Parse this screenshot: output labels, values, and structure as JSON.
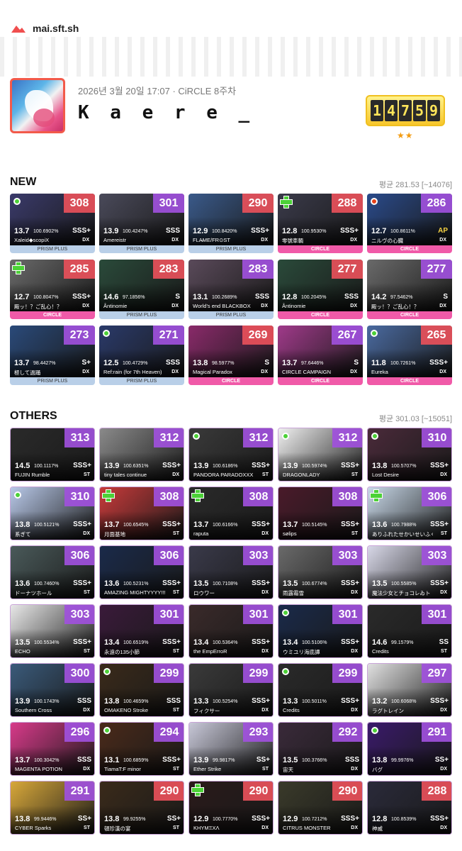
{
  "site": {
    "name": "mai.sft.sh"
  },
  "profile": {
    "date": "2026년 3월 20일 17:07 · CiRCLE 8주차",
    "name": "K a e r e _",
    "rating": "14759",
    "rating_digits": [
      "1",
      "4",
      "7",
      "5",
      "9"
    ],
    "stars": "★★"
  },
  "new": {
    "title": "NEW",
    "avg": "평균 281.53 [~14076]",
    "cards": [
      {
        "score": "308",
        "lvl": "13.7",
        "acc": "100.6902%",
        "rank": "SSS+",
        "title": "Xaleid◆scopiX",
        "type": "DX",
        "ver": "PRISM PLUS",
        "mark": "dot-green",
        "color": "#3a3a6a"
      },
      {
        "score": "301",
        "lvl": "13.9",
        "acc": "100.4247%",
        "rank": "SSS",
        "title": "Amereistr",
        "type": "DX",
        "ver": "PRISM PLUS",
        "mark": "",
        "color": "#4a4a5a"
      },
      {
        "score": "290",
        "lvl": "12.9",
        "acc": "100.8420%",
        "rank": "SSS+",
        "title": "FLA̶ME/FR⊙ST",
        "type": "DX",
        "ver": "PRISM PLUS",
        "mark": "",
        "color": "#3a5a8a"
      },
      {
        "score": "288",
        "lvl": "12.8",
        "acc": "100.9530%",
        "rank": "SSS+",
        "title": "零號車輌",
        "type": "DX",
        "ver": "CIRCLE",
        "mark": "plus",
        "color": "#3a3a4a"
      },
      {
        "score": "286",
        "lvl": "12.7",
        "acc": "100.8611%",
        "rank": "AP",
        "title": "ニルヴの心臓",
        "type": "DX",
        "ver": "CIRCLE",
        "mark": "dot-red",
        "color": "#2a4a8a"
      },
      {
        "score": "285",
        "lvl": "12.7",
        "acc": "100.8047%",
        "rank": "SSS+",
        "title": "殿ッ！？ご乱心！？",
        "type": "DX",
        "ver": "CIRCLE",
        "mark": "plus",
        "color": "#6a6a6a"
      },
      {
        "score": "283",
        "lvl": "14.6",
        "acc": "97.1856%",
        "rank": "S",
        "title": "Ântinomie",
        "type": "DX",
        "ver": "PRISM PLUS",
        "mark": "",
        "color": "#2a4a3a"
      },
      {
        "score": "283",
        "lvl": "13.1",
        "acc": "100.2689%",
        "rank": "SSS",
        "title": "World's end BLACKBOX",
        "type": "DX",
        "ver": "PRISM PLUS",
        "mark": "",
        "color": "#5a4a5a"
      },
      {
        "score": "277",
        "lvl": "12.8",
        "acc": "100.2045%",
        "rank": "SSS",
        "title": "Ântinomie",
        "type": "DX",
        "ver": "CIRCLE",
        "mark": "",
        "color": "#2a4a3a"
      },
      {
        "score": "277",
        "lvl": "14.2",
        "acc": "97.5462%",
        "rank": "S",
        "title": "殿ッ！？ご乱心！？",
        "type": "DX",
        "ver": "CIRCLE",
        "mark": "",
        "color": "#6a6a6a"
      },
      {
        "score": "273",
        "lvl": "13.7",
        "acc": "98.4427%",
        "rank": "S+",
        "title": "極して過踊",
        "type": "DX",
        "ver": "PRISM PLUS",
        "mark": "",
        "color": "#2a4a7a"
      },
      {
        "score": "271",
        "lvl": "12.5",
        "acc": "100.4729%",
        "rank": "SSS",
        "title": "Ref:rain (for 7th Heaven)",
        "type": "DX",
        "ver": "PRISM PLUS",
        "mark": "dot-green",
        "color": "#2a3a6a"
      },
      {
        "score": "269",
        "lvl": "13.8",
        "acc": "98.5977%",
        "rank": "S",
        "title": "Magical Paradox",
        "type": "DX",
        "ver": "CIRCLE",
        "mark": "",
        "color": "#8a2a6a"
      },
      {
        "score": "267",
        "lvl": "13.7",
        "acc": "97.6446%",
        "rank": "S",
        "title": "CIRCLE CAMPAIGN",
        "type": "DX",
        "ver": "CIRCLE",
        "mark": "",
        "color": "#a03a8a"
      },
      {
        "score": "265",
        "lvl": "11.8",
        "acc": "100.7261%",
        "rank": "SSS+",
        "title": "Eureka",
        "type": "DX",
        "ver": "CIRCLE",
        "mark": "dot-green",
        "color": "#4a6aa0"
      }
    ]
  },
  "others": {
    "title": "OTHERS",
    "avg": "평균 301.03 [~15051]",
    "cards": [
      {
        "score": "313",
        "lvl": "14.5",
        "acc": "100.1117%",
        "rank": "SSS+",
        "title": "FUJIN Rumble",
        "type": "ST",
        "mark": "",
        "color": "#2a2a2a"
      },
      {
        "score": "312",
        "lvl": "13.9",
        "acc": "100.6351%",
        "rank": "SSS+",
        "title": "tiny tales continue",
        "type": "DX",
        "mark": "",
        "color": "#8a8a8a"
      },
      {
        "score": "312",
        "lvl": "13.9",
        "acc": "100.6186%",
        "rank": "SSS+",
        "title": "PANDORA PARADOXXX",
        "type": "ST",
        "mark": "dot-green",
        "color": "#3a3a3a"
      },
      {
        "score": "312",
        "lvl": "13.9",
        "acc": "100.5974%",
        "rank": "SSS+",
        "title": "DRAGONLADY",
        "type": "ST",
        "mark": "dot-green",
        "color": "#f0f0f0"
      },
      {
        "score": "310",
        "lvl": "13.8",
        "acc": "100.5707%",
        "rank": "SSS+",
        "title": "Lost Desire",
        "type": "DX",
        "mark": "dot-green",
        "color": "#4a2a3a"
      },
      {
        "score": "310",
        "lvl": "13.8",
        "acc": "100.5121%",
        "rank": "SSS+",
        "title": "系ぎて",
        "type": "DX",
        "mark": "dot-green",
        "color": "#b8c8e8"
      },
      {
        "score": "308",
        "lvl": "13.7",
        "acc": "100.6545%",
        "rank": "SSS+",
        "title": "月面基地",
        "type": "ST",
        "mark": "plus",
        "color": "#c83a3a"
      },
      {
        "score": "308",
        "lvl": "13.7",
        "acc": "100.6166%",
        "rank": "SSS+",
        "title": "raputa",
        "type": "DX",
        "mark": "plus",
        "color": "#2a2a2a"
      },
      {
        "score": "308",
        "lvl": "13.7",
        "acc": "100.5145%",
        "rank": "SSS+",
        "title": "sølips",
        "type": "ST",
        "mark": "",
        "color": "#4a1a2a"
      },
      {
        "score": "306",
        "lvl": "13.6",
        "acc": "100.7988%",
        "rank": "SSS+",
        "title": "ありふれたせかいせいふく",
        "type": "ST",
        "mark": "plus",
        "color": "#c8d8e8"
      },
      {
        "score": "306",
        "lvl": "13.6",
        "acc": "100.7460%",
        "rank": "SSS+",
        "title": "ドーナツホール",
        "type": "ST",
        "mark": "",
        "color": "#4a5a5a"
      },
      {
        "score": "306",
        "lvl": "13.6",
        "acc": "100.5231%",
        "rank": "SSS+",
        "title": "AMAZING MIGHTYYYY!!!!",
        "type": "ST",
        "mark": "",
        "color": "#1a2a4a"
      },
      {
        "score": "303",
        "lvl": "13.5",
        "acc": "100.7108%",
        "rank": "SSS+",
        "title": "ロウワー",
        "type": "DX",
        "mark": "",
        "color": "#3a3a4a"
      },
      {
        "score": "303",
        "lvl": "13.5",
        "acc": "100.6774%",
        "rank": "SSS+",
        "title": "雨露霜雪",
        "type": "DX",
        "mark": "",
        "color": "#6a6a6a"
      },
      {
        "score": "303",
        "lvl": "13.5",
        "acc": "100.5585%",
        "rank": "SSS+",
        "title": "魔法少女とチョコレゐト",
        "type": "DX",
        "mark": "",
        "color": "#d8d8e8"
      },
      {
        "score": "303",
        "lvl": "13.5",
        "acc": "100.5534%",
        "rank": "SSS+",
        "title": "ECHO",
        "type": "ST",
        "mark": "",
        "color": "#e8e8e8"
      },
      {
        "score": "301",
        "lvl": "13.4",
        "acc": "100.6519%",
        "rank": "SSS+",
        "title": "永遠の135小節",
        "type": "ST",
        "mark": "",
        "color": "#3a1a3a"
      },
      {
        "score": "301",
        "lvl": "13.4",
        "acc": "100.5364%",
        "rank": "SSS+",
        "title": "the EmpErroR",
        "type": "DX",
        "mark": "",
        "color": "#3a2a2a"
      },
      {
        "score": "301",
        "lvl": "13.4",
        "acc": "100.5106%",
        "rank": "SSS+",
        "title": "ウミユリ海底譚",
        "type": "DX",
        "mark": "dot-green",
        "color": "#1a2a4a"
      },
      {
        "score": "301",
        "lvl": "14.6",
        "acc": "99.1579%",
        "rank": "SS",
        "title": "Credits",
        "type": "ST",
        "mark": "",
        "color": "#2a2a2a"
      },
      {
        "score": "300",
        "lvl": "13.9",
        "acc": "100.1743%",
        "rank": "SSS",
        "title": "Southern Cross",
        "type": "DX",
        "mark": "",
        "color": "#3a5a7a"
      },
      {
        "score": "299",
        "lvl": "13.8",
        "acc": "100.4659%",
        "rank": "SSS",
        "title": "OMAKENO Stroke",
        "type": "ST",
        "mark": "dot-green",
        "color": "#3a2a1a"
      },
      {
        "score": "299",
        "lvl": "13.3",
        "acc": "100.5254%",
        "rank": "SSS+",
        "title": "フィクサー",
        "type": "DX",
        "mark": "",
        "color": "#3a3a3a"
      },
      {
        "score": "299",
        "lvl": "13.3",
        "acc": "100.5011%",
        "rank": "SSS+",
        "title": "Credits",
        "type": "DX",
        "mark": "dot-green",
        "color": "#2a2a2a"
      },
      {
        "score": "297",
        "lvl": "13.2",
        "acc": "100.6068%",
        "rank": "SSS+",
        "title": "ラグトレイン",
        "type": "DX",
        "mark": "",
        "color": "#e0e0e0"
      },
      {
        "score": "296",
        "lvl": "13.7",
        "acc": "100.3042%",
        "rank": "SSS",
        "title": "MAGENTA POTION",
        "type": "DX",
        "mark": "",
        "color": "#d83a8a"
      },
      {
        "score": "294",
        "lvl": "13.1",
        "acc": "100.6859%",
        "rank": "SSS+",
        "title": "TiamaT:F minor",
        "type": "ST",
        "mark": "dot-green",
        "color": "#4a2a1a"
      },
      {
        "score": "293",
        "lvl": "13.9",
        "acc": "99.9817%",
        "rank": "SS+",
        "title": "Ether Strike",
        "type": "ST",
        "mark": "",
        "color": "#c8c8d8"
      },
      {
        "score": "292",
        "lvl": "13.5",
        "acc": "100.3766%",
        "rank": "SSS",
        "title": "宙天",
        "type": "DX",
        "mark": "",
        "color": "#3a2a3a"
      },
      {
        "score": "291",
        "lvl": "13.8",
        "acc": "99.9976%",
        "rank": "SS+",
        "title": "バグ",
        "type": "DX",
        "mark": "dot-green",
        "color": "#3a1a6a"
      },
      {
        "score": "291",
        "lvl": "13.8",
        "acc": "99.9446%",
        "rank": "SS+",
        "title": "CYBER Sparks",
        "type": "ST",
        "mark": "",
        "color": "#d8a83a"
      },
      {
        "score": "290",
        "lvl": "13.8",
        "acc": "99.9255%",
        "rank": "SS+",
        "title": "頓珍漢の宴",
        "type": "ST",
        "mark": "",
        "color": "#3a2a1a"
      },
      {
        "score": "290",
        "lvl": "12.9",
        "acc": "100.7770%",
        "rank": "SSS+",
        "title": "KHYMΞXΛ",
        "type": "DX",
        "mark": "plus",
        "color": "#2a1a1a"
      },
      {
        "score": "290",
        "lvl": "12.9",
        "acc": "100.7212%",
        "rank": "SSS+",
        "title": "CITRUS MONSTER",
        "type": "DX",
        "mark": "",
        "color": "#3a3a2a"
      },
      {
        "score": "288",
        "lvl": "12.8",
        "acc": "100.8539%",
        "rank": "SSS+",
        "title": "神威",
        "type": "DX",
        "mark": "",
        "color": "#2a2a3a"
      }
    ]
  }
}
